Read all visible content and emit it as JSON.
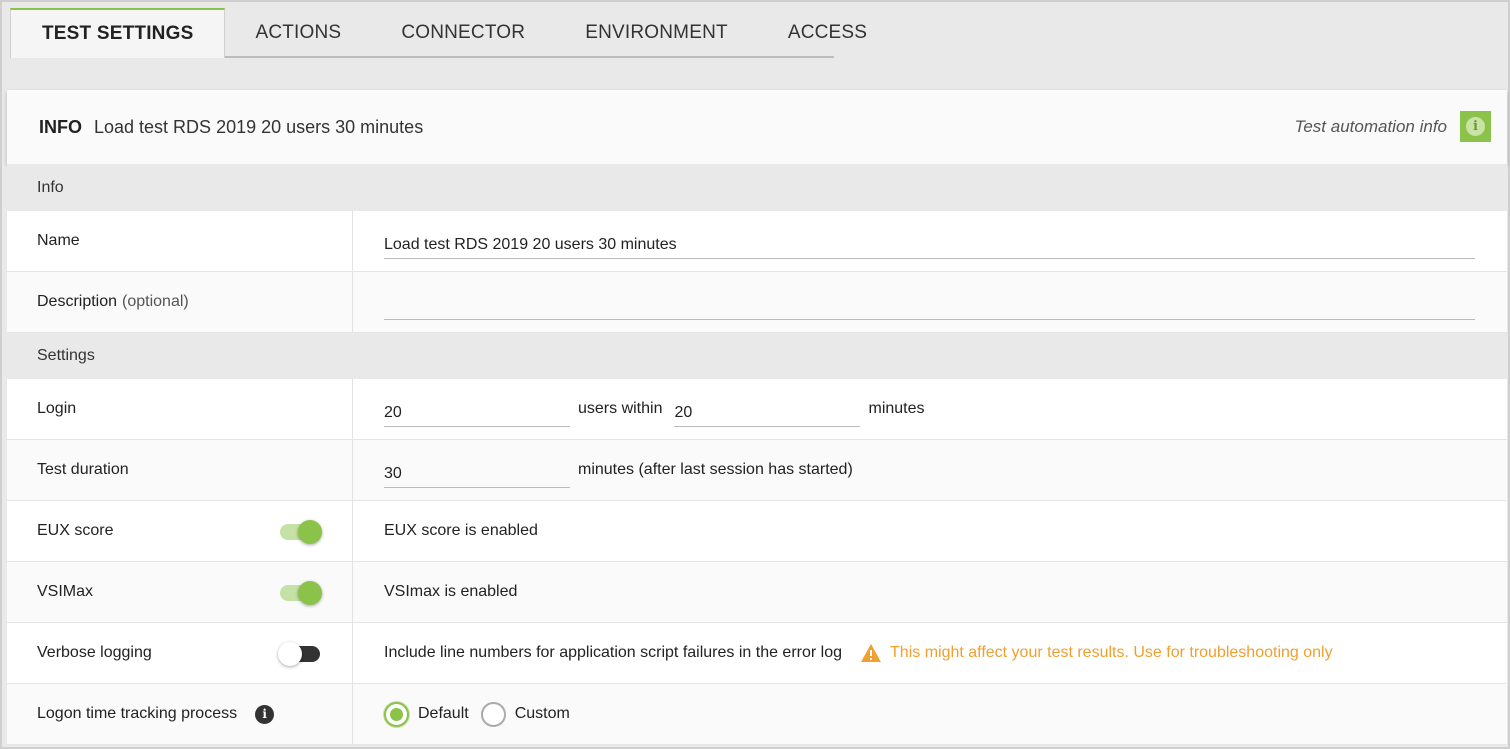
{
  "tabs": [
    {
      "label": "TEST SETTINGS",
      "active": true
    },
    {
      "label": "ACTIONS"
    },
    {
      "label": "CONNECTOR"
    },
    {
      "label": "ENVIRONMENT"
    },
    {
      "label": "ACCESS"
    }
  ],
  "header": {
    "title": "INFO",
    "name": "Load test RDS 2019 20 users 30 minutes",
    "automation_info": "Test automation info",
    "info_icon": "info-icon"
  },
  "sections": {
    "info": "Info",
    "settings": "Settings"
  },
  "fields": {
    "name": {
      "label": "Name",
      "value": "Load test RDS 2019 20 users 30 minutes"
    },
    "description": {
      "label": "Description",
      "optional": "(optional)",
      "value": ""
    },
    "login": {
      "label": "Login",
      "users": "20",
      "users_within": "users within",
      "minutes_value": "20",
      "minutes": "minutes"
    },
    "test_duration": {
      "label": "Test duration",
      "value": "30",
      "suffix": "minutes (after last session has started)"
    },
    "eux_score": {
      "label": "EUX score",
      "enabled": true,
      "status": "EUX score is enabled"
    },
    "vsimax": {
      "label": "VSIMax",
      "enabled": true,
      "status": "VSImax is enabled"
    },
    "verbose_logging": {
      "label": "Verbose logging",
      "enabled": false,
      "description": "Include line numbers for application script failures in the error log",
      "warning": "This might affect your test results. Use for troubleshooting only"
    },
    "logon_tracking": {
      "label": "Logon time tracking process",
      "options": [
        "Default",
        "Custom"
      ],
      "selected": "Default"
    }
  },
  "colors": {
    "accent": "#8bc34a",
    "warning": "#f0a030"
  }
}
